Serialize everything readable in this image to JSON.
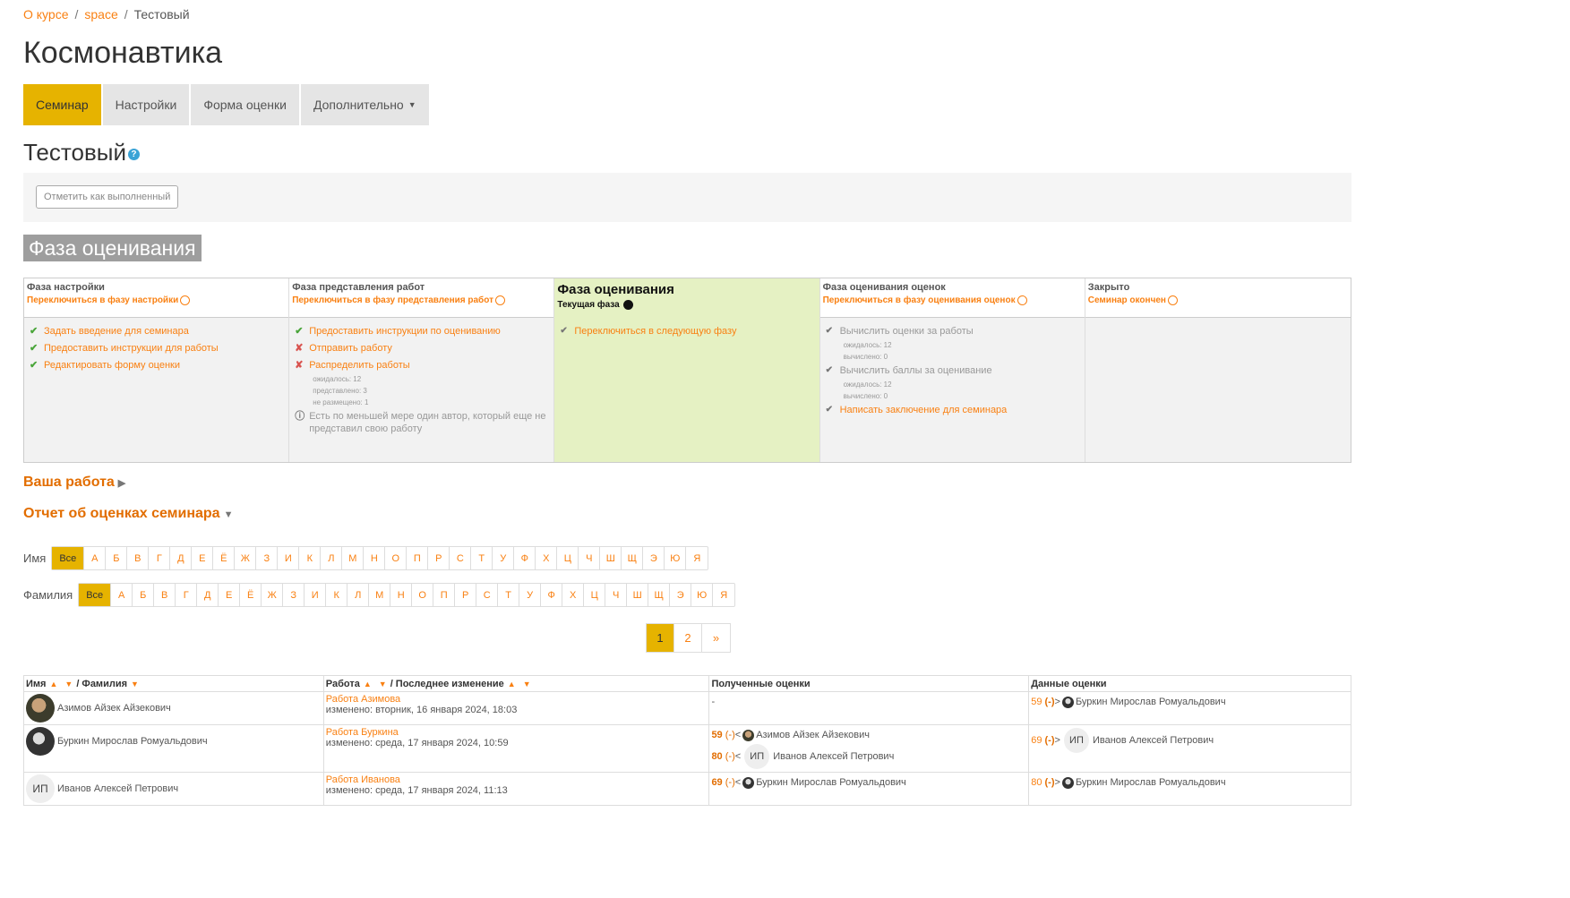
{
  "breadcrumb": {
    "items": [
      "О курсе",
      "space"
    ],
    "current": "Тестовый"
  },
  "course_title": "Космонавтика",
  "tabs": [
    {
      "label": "Семинар"
    },
    {
      "label": "Настройки"
    },
    {
      "label": "Форма оценки"
    },
    {
      "label": "Дополнительно"
    }
  ],
  "activity": {
    "title": "Тестовый",
    "help": "?"
  },
  "completion_button": "Отметить как выполненный",
  "phase_banner": "Фаза оценивания",
  "phases": [
    {
      "name": "Фаза настройки",
      "switch": "Переключиться в фазу настройки",
      "tasks": [
        {
          "icon": "✔",
          "text": "Задать введение для семинара"
        },
        {
          "icon": "✔",
          "text": "Предоставить инструкции для работы"
        },
        {
          "icon": "✔",
          "text": "Редактировать форму оценки"
        }
      ]
    },
    {
      "name": "Фаза представления работ",
      "switch": "Переключиться в фазу представления работ",
      "tasks": [
        {
          "icon": "✔",
          "text": "Предоставить инструкции по оцениванию"
        },
        {
          "icon": "✘",
          "text": "Отправить работу"
        },
        {
          "icon": "✘",
          "text": "Распределить работы",
          "details": [
            "ожидалось: 12",
            "представлено: 3",
            "не размещено: 1"
          ]
        },
        {
          "icon": "ⓘ",
          "text": "Есть по меньшей мере один автор, который еще не представил свою работу"
        }
      ]
    },
    {
      "name": "Фаза оценивания",
      "current_label": "Текущая фаза",
      "tasks": [
        {
          "icon": "✔",
          "text": "Переключиться в следующую фазу"
        }
      ]
    },
    {
      "name": "Фаза оценивания оценок",
      "switch": "Переключиться в фазу оценивания оценок",
      "tasks": [
        {
          "icon": "✔",
          "text": "Вычислить оценки за работы",
          "details": [
            "ожидалось: 12",
            "вычислено: 0"
          ]
        },
        {
          "icon": "✔",
          "text": "Вычислить баллы за оценивание",
          "details": [
            "ожидалось: 12",
            "вычислено: 0"
          ]
        },
        {
          "icon": "✔",
          "text": "Написать заключение для семинара"
        }
      ]
    },
    {
      "name": "Закрыто",
      "switch": "Семинар окончен"
    }
  ],
  "your_work": "Ваша работа",
  "grades_report": "Отчет об оценках семинара",
  "firstname_filter": {
    "label": "Имя",
    "letters": [
      "Все",
      "А",
      "Б",
      "В",
      "Г",
      "Д",
      "Е",
      "Ё",
      "Ж",
      "З",
      "И",
      "К",
      "Л",
      "М",
      "Н",
      "О",
      "П",
      "Р",
      "С",
      "Т",
      "У",
      "Ф",
      "Х",
      "Ц",
      "Ч",
      "Ш",
      "Щ",
      "Э",
      "Ю",
      "Я"
    ]
  },
  "lastname_filter": {
    "label": "Фамилия",
    "letters": [
      "Все",
      "А",
      "Б",
      "В",
      "Г",
      "Д",
      "Е",
      "Ё",
      "Ж",
      "З",
      "И",
      "К",
      "Л",
      "М",
      "Н",
      "О",
      "П",
      "Р",
      "С",
      "Т",
      "У",
      "Ф",
      "Х",
      "Ц",
      "Ч",
      "Ш",
      "Щ",
      "Э",
      "Ю",
      "Я"
    ]
  },
  "pagination": [
    "1",
    "2",
    "»"
  ],
  "table": {
    "headers": {
      "firstname": "Имя",
      "lastname": "/ Фамилия",
      "work": "Работа",
      "modified": "/ Последнее изменение",
      "received": "Полученные оценки",
      "given": "Данные оценки"
    },
    "rows": [
      {
        "name": "Азимов Айзек Айзекович",
        "avatar": "photo",
        "work": "Работа Азимова",
        "modified": "изменено: вторник, 16 января 2024, 18:03",
        "received": [
          {
            "text": "-"
          }
        ],
        "given": [
          {
            "grade": "59",
            "gg": "(-)",
            "arrow": ">",
            "avatar": "p2",
            "name": "Буркин Мирослав Ромуальдович"
          }
        ]
      },
      {
        "name": "Буркин Мирослав Ромуальдович",
        "avatar": "photo",
        "work": "Работа Буркина",
        "modified": "изменено: среда, 17 января 2024, 10:59",
        "received": [
          {
            "grade": "59",
            "gg": "(-)",
            "arrow": "<",
            "avatar": "p1",
            "name": "Азимов Айзек Айзекович"
          },
          {
            "grade": "80",
            "gg": "(-)",
            "arrow": "<",
            "initials": "ИП",
            "name": "Иванов Алексей Петрович"
          }
        ],
        "given": [
          {
            "grade": "69",
            "gg": "(-)",
            "arrow": ">",
            "initials": "ИП",
            "name": "Иванов Алексей Петрович"
          }
        ]
      },
      {
        "name": "Иванов Алексей Петрович",
        "initials": "ИП",
        "work": "Работа Иванова",
        "modified": "изменено: среда, 17 января 2024, 11:13",
        "received": [
          {
            "grade": "69",
            "gg": "(-)",
            "arrow": "<",
            "avatar": "p2",
            "name": "Буркин Мирослав Ромуальдович"
          }
        ],
        "given": [
          {
            "grade": "80",
            "gg": "(-)",
            "arrow": ">",
            "avatar": "p2",
            "name": "Буркин Мирослав Ромуальдович"
          }
        ]
      }
    ]
  },
  "colors": {
    "accent": "#f98012",
    "active_tab": "#e6b300",
    "current_phase_bg": "#e5f1c3"
  }
}
